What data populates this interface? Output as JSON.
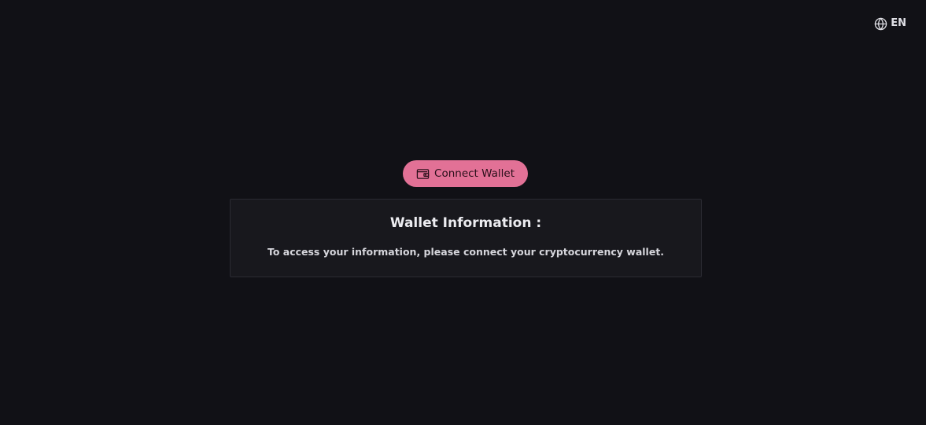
{
  "header": {
    "language_icon": "globe-icon",
    "language_label": "EN"
  },
  "connect": {
    "icon": "wallet-icon",
    "label": "Connect Wallet"
  },
  "wallet_info": {
    "title": "Wallet Information :",
    "message": "To access your information, please connect your cryptocurrency wallet."
  },
  "colors": {
    "background": "#111116",
    "accent": "#e27196",
    "card": "#18181d"
  }
}
